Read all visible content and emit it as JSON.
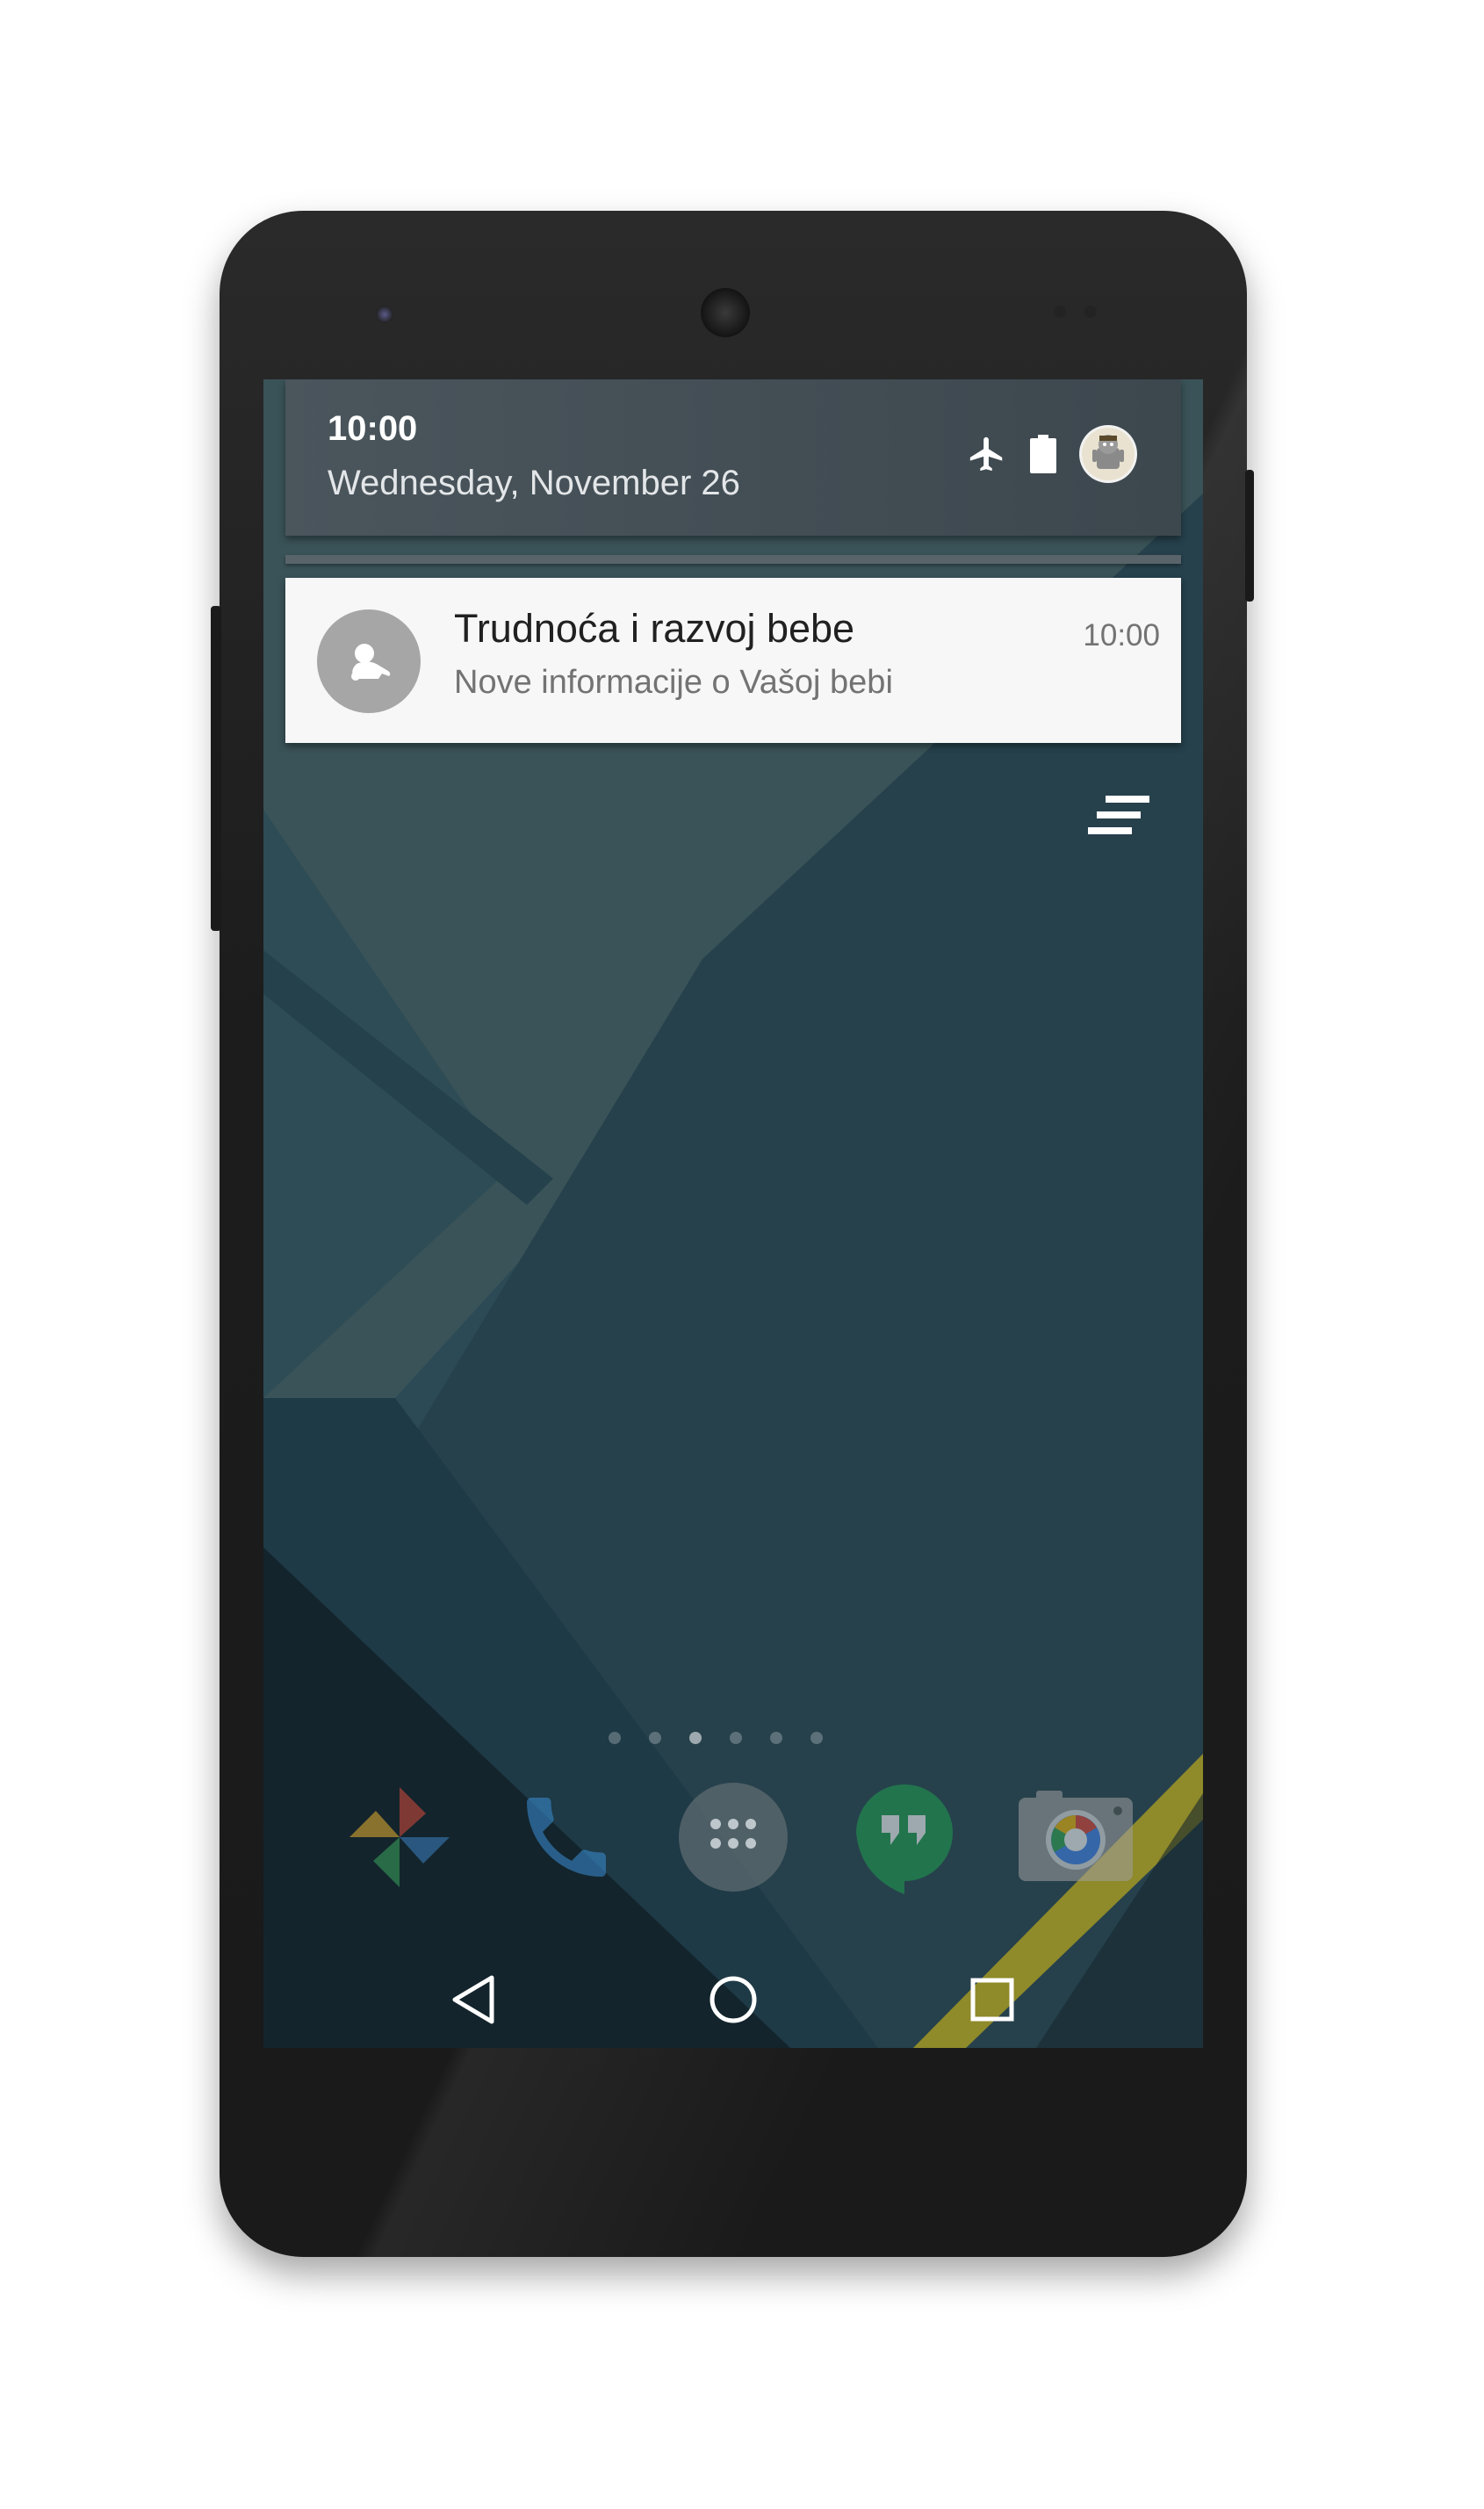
{
  "quick_settings": {
    "time": "10:00",
    "date": "Wednesday, November 26",
    "icons": [
      "airplane-mode-icon",
      "battery-icon",
      "user-avatar"
    ]
  },
  "notification": {
    "app_icon": "baby-icon",
    "title": "Trudnoća i razvoj bebe",
    "text": "Nove informacije o Vašoj bebi",
    "time": "10:00"
  },
  "clear_all": {
    "icon": "clear-all-icon"
  },
  "home": {
    "page_count": 6,
    "active_page": 3,
    "dock": [
      "photos-icon",
      "phone-icon",
      "app-drawer-icon",
      "hangouts-icon",
      "camera-icon"
    ]
  },
  "navigation": [
    "back-icon",
    "home-icon",
    "recents-icon"
  ],
  "colors": {
    "notification_bg": "#f7f7f7",
    "quick_settings_bg": "#4a555c",
    "wallpaper_dark": "#1e3a46",
    "wallpaper_accent": "#c9b62a"
  }
}
